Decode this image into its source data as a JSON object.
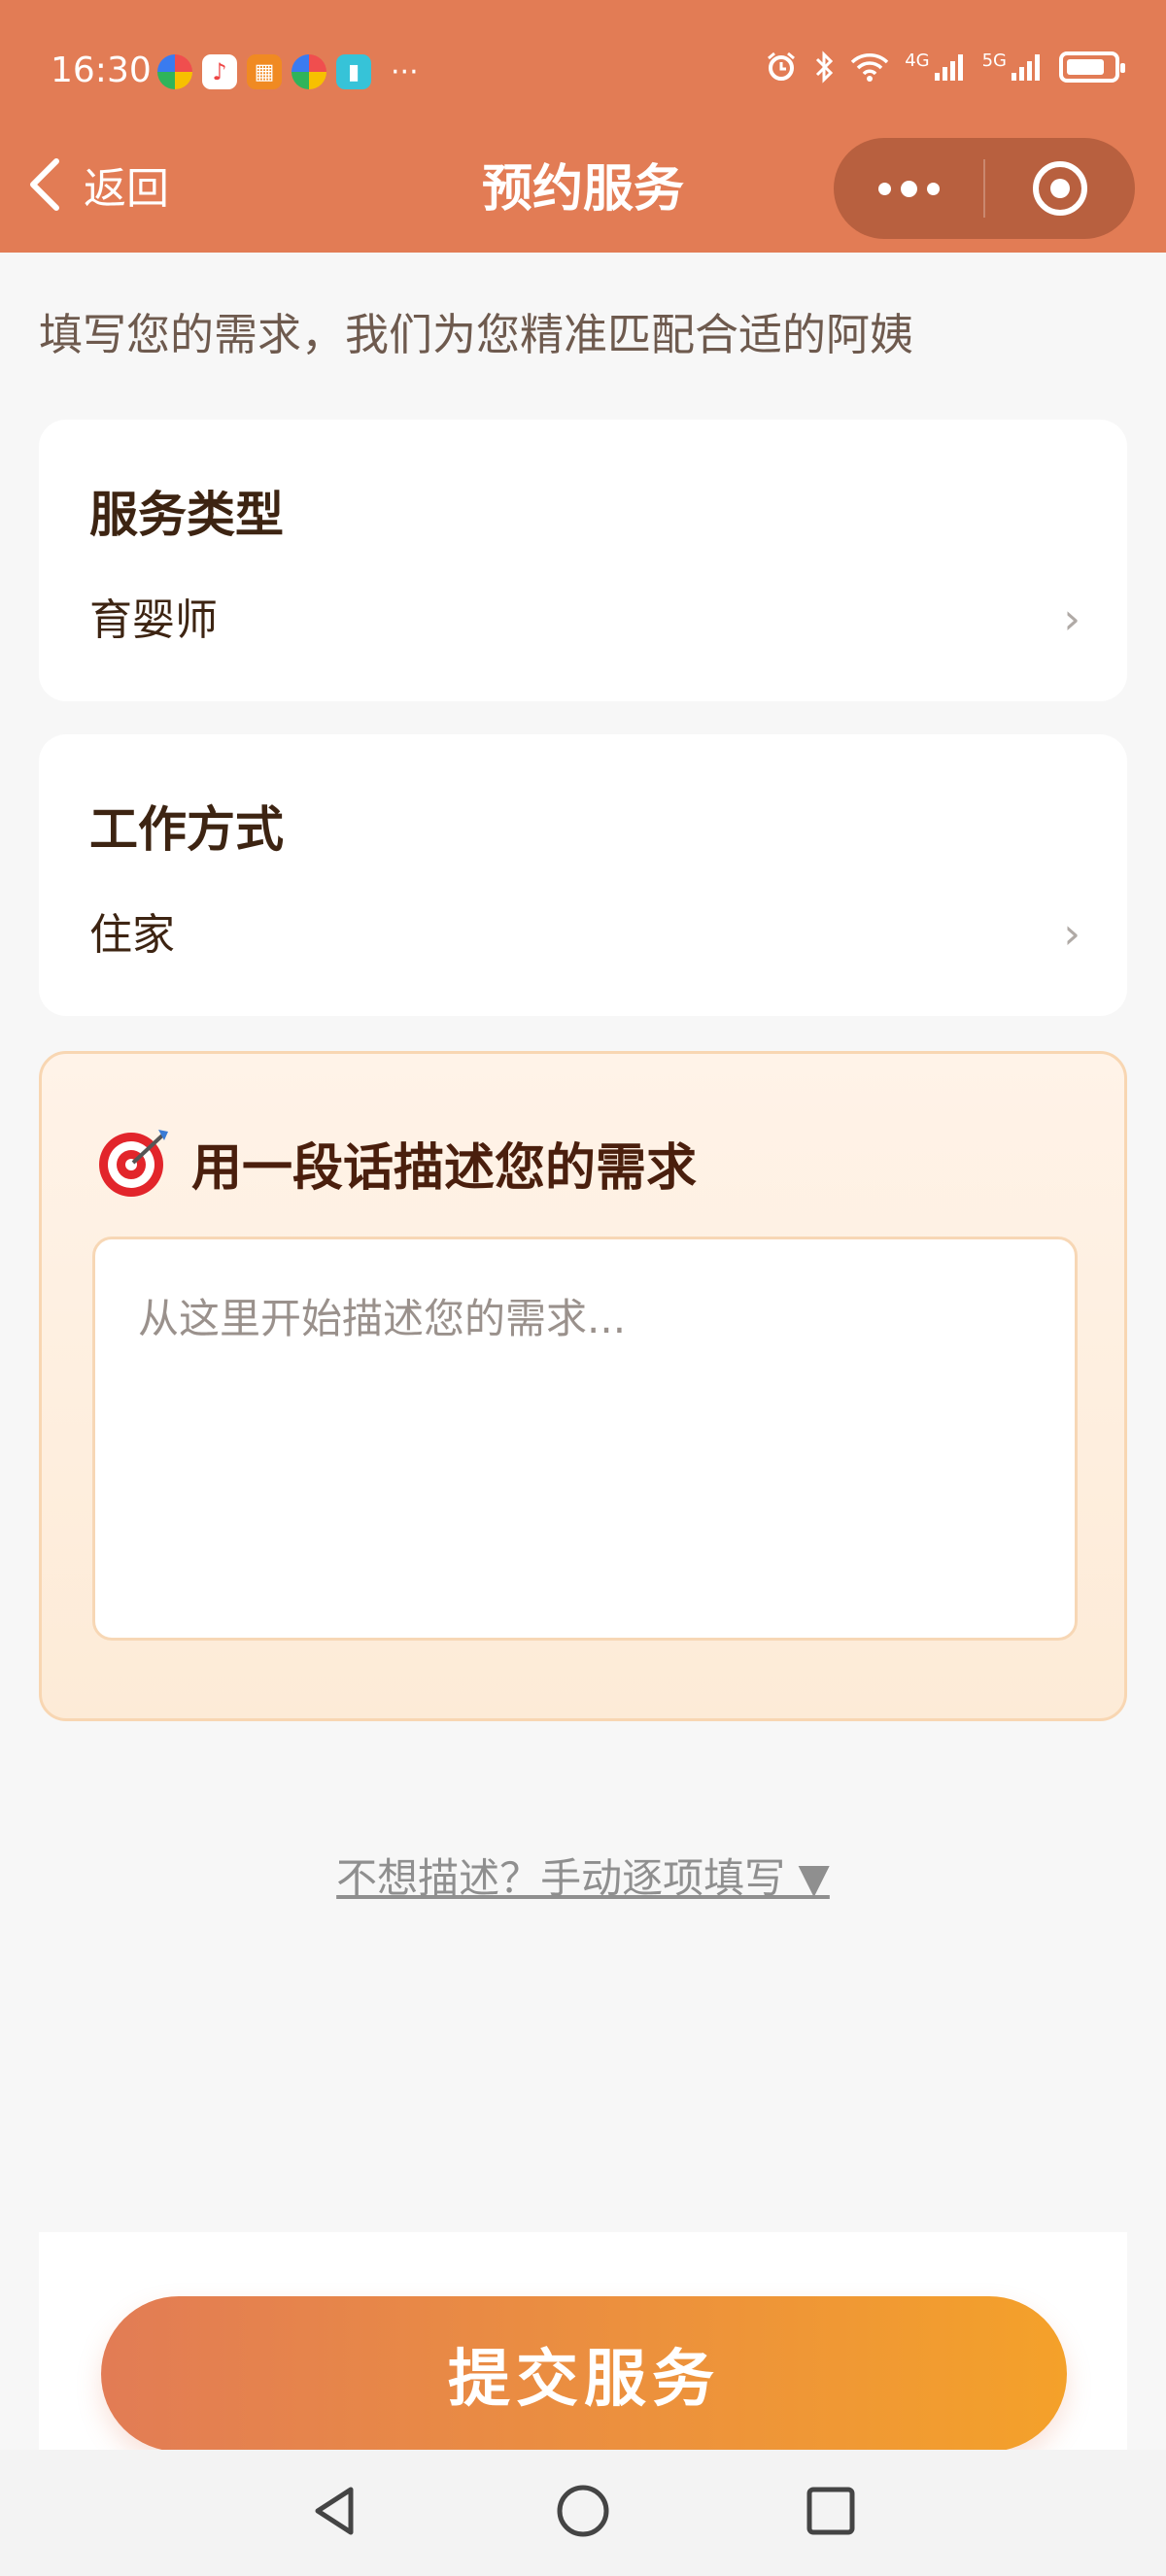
{
  "status_bar": {
    "time": "16:30",
    "more": "···",
    "net1": "4G",
    "net2": "5G"
  },
  "nav": {
    "back_label": "返回",
    "title": "预约服务"
  },
  "intro": "填写您的需求，我们为您精准匹配合适的阿姨",
  "service_type": {
    "title": "服务类型",
    "value": "育婴师"
  },
  "work_mode": {
    "title": "工作方式",
    "value": "住家"
  },
  "description": {
    "icon": "🎯",
    "title": "用一段话描述您的需求",
    "placeholder": "从这里开始描述您的需求..."
  },
  "manual_link": "不想描述？手动逐项填写 ▼",
  "submit_label": "提交服务",
  "colors": {
    "brand": "#e27c55",
    "gradient_end": "#f4a12a"
  }
}
